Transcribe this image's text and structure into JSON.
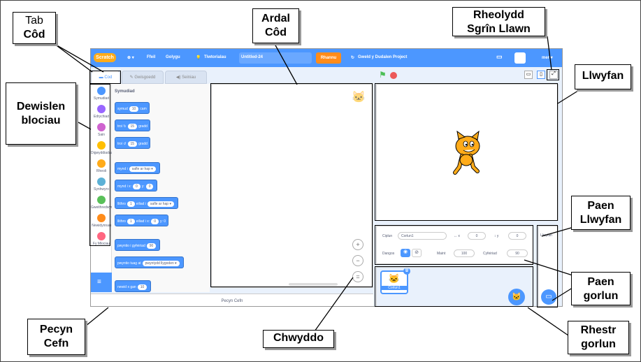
{
  "menubar": {
    "logo": "Scratch",
    "globe": "⊕ ▾",
    "file": "Ffeil",
    "edit": "Golygu",
    "tutorials": "Tiwtorialau",
    "project_title": "Untitled-24",
    "share": "Rhannu",
    "see_project_page": "Gweld y Dudalen Project",
    "user": "mer ▾"
  },
  "tabs": {
    "code": "Cod",
    "costumes": "Gwisgoedd",
    "sounds": "Seiniau"
  },
  "categories": [
    {
      "label": "Symudiad",
      "color": "#4c97ff"
    },
    {
      "label": "Edrychiad",
      "color": "#9966ff"
    },
    {
      "label": "Sain",
      "color": "#cf63cf"
    },
    {
      "label": "Digwyddiadau",
      "color": "#ffbf00"
    },
    {
      "label": "Rheoli",
      "color": "#ffab19"
    },
    {
      "label": "Synhwyro",
      "color": "#5cb1d6"
    },
    {
      "label": "Gweithredwyr",
      "color": "#59c059"
    },
    {
      "label": "Newidynnau",
      "color": "#ff8c1a"
    },
    {
      "label": "Fy Mlociau",
      "color": "#ff6680"
    }
  ],
  "palette": {
    "title": "Symudiad",
    "blocks": [
      {
        "pre": "symud",
        "v1": "10",
        "post": "cam",
        "v2": "",
        "post2": ""
      },
      {
        "pre": "troi ↻",
        "v1": "15",
        "post": "gradd",
        "v2": "",
        "post2": ""
      },
      {
        "pre": "troi ↺",
        "v1": "15",
        "post": "gradd",
        "v2": "",
        "post2": ""
      },
      {
        "pre": "mynd i",
        "v1": "safle ar hap ▾",
        "post": "",
        "v2": "",
        "post2": ""
      },
      {
        "pre": "mynd i x:",
        "v1": "0",
        "post": "y:",
        "v2": "0",
        "post2": ""
      },
      {
        "pre": "llithro",
        "v1": "1",
        "post": "eiliad i",
        "v2": "safle ar hap ▾",
        "post2": ""
      },
      {
        "pre": "llithro",
        "v1": "1",
        "post": "eiliad i x:",
        "v2": "0",
        "post2": "y: 0"
      },
      {
        "pre": "pwyntio i gyfeiriad",
        "v1": "90",
        "post": "",
        "v2": "",
        "post2": ""
      },
      {
        "pre": "pwyntio tuag at",
        "v1": "pwyntydd llygoden ▾",
        "post": "",
        "v2": "",
        "post2": ""
      },
      {
        "pre": "newid x gan",
        "v1": "10",
        "post": "",
        "v2": "",
        "post2": ""
      }
    ]
  },
  "backpack": "Pecyn Cefn",
  "sprite_info": {
    "sprite_label": "Ciplun",
    "sprite_name": "Corlun1",
    "x_label": "↔ x",
    "x_value": "0",
    "y_label": "↕ y",
    "y_value": "0",
    "show_label": "Dangos",
    "size_label": "Maint",
    "size_value": "100",
    "direction_label": "Cyfeiriad",
    "direction_value": "90"
  },
  "sprite_thumb": "Corlun1",
  "stage_pane_label": "Llwyfan",
  "callouts": {
    "tab_line1": "Tab",
    "tab_line2": "Côd",
    "code_area_line1": "Ardal",
    "code_area_line2": "Côd",
    "fullscreen_line1": "Rheolydd",
    "fullscreen_line2": "Sgrîn Llawn",
    "stage": "Llwyfan",
    "blocks_menu_line1": "Dewislen",
    "blocks_menu_line2": "blociau",
    "stage_pane_line1": "Paen",
    "stage_pane_line2": "Llwyfan",
    "sprite_pane_line1": "Paen",
    "sprite_pane_line2": "gorlun",
    "backpack_line1": "Pecyn",
    "backpack_line2": "Cefn",
    "zoom": "Chwyddo",
    "sprite_list_line1": "Rhestr",
    "sprite_list_line2": "gorlun"
  }
}
